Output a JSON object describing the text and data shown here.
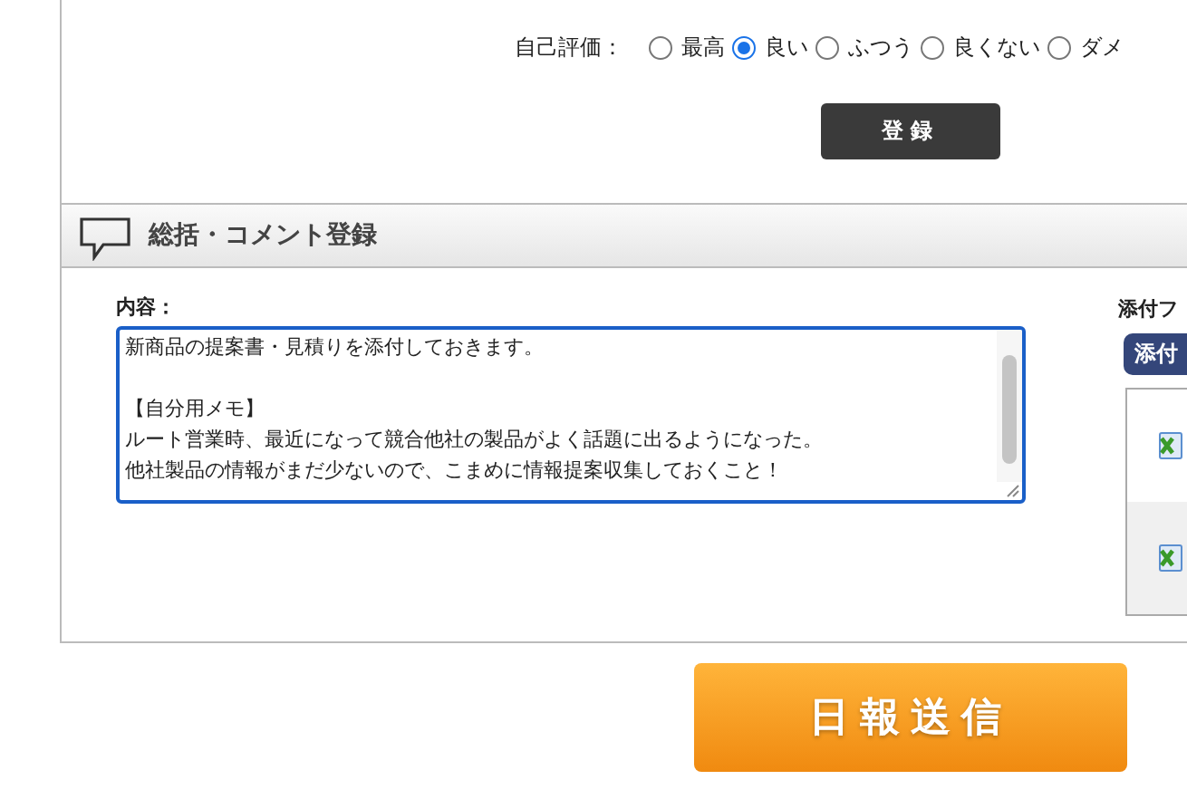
{
  "self_rating": {
    "label": "自己評価：",
    "options": [
      {
        "label": "最高",
        "selected": false
      },
      {
        "label": "良い",
        "selected": true
      },
      {
        "label": "ふつう",
        "selected": false
      },
      {
        "label": "良くない",
        "selected": false
      },
      {
        "label": "ダメ",
        "selected": false
      }
    ]
  },
  "register_button": "登録",
  "summary_section": {
    "title": "総括・コメント登録",
    "content_label": "内容：",
    "content_paragraphs": [
      [
        "新商品の提案書・見積りを添付しておきます。"
      ],
      [
        "【自分用メモ】",
        "ルート営業時、最近になって競合他社の製品がよく話題に出るようになった。",
        "他社製品の情報がまだ少ないので、こまめに情報提案収集しておくこと！"
      ]
    ]
  },
  "attachments": {
    "label": "添付フ",
    "button": "添付",
    "files": [
      {
        "kind": "excel"
      },
      {
        "kind": "excel"
      }
    ]
  },
  "submit_button": "日報送信"
}
